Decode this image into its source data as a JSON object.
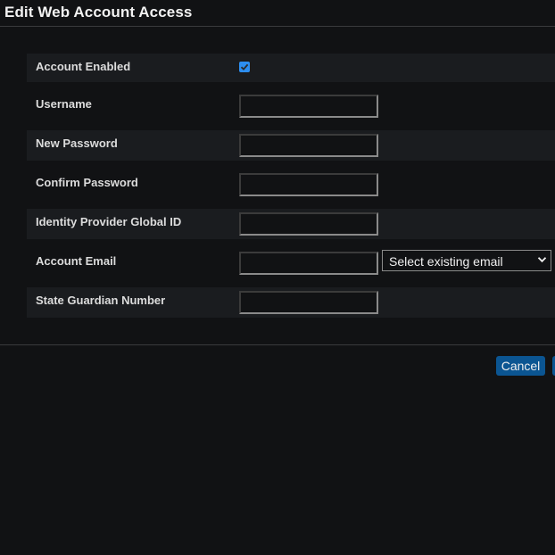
{
  "dialog": {
    "title": "Edit Web Account Access"
  },
  "fields": [
    {
      "label": "Account Enabled",
      "type": "checkbox",
      "checked": true
    },
    {
      "label": "Username",
      "type": "text",
      "value": ""
    },
    {
      "label": "New Password",
      "type": "password",
      "value": ""
    },
    {
      "label": "Confirm Password",
      "type": "password",
      "value": ""
    },
    {
      "label": "Identity Provider Global ID",
      "type": "text",
      "value": ""
    },
    {
      "label": "Account Email",
      "type": "text",
      "value": "",
      "select_value": "Select existing email"
    },
    {
      "label": "State Guardian Number",
      "type": "text",
      "value": ""
    }
  ],
  "footer": {
    "cancel_label": "Cancel"
  },
  "colors": {
    "accent": "#2d8ef0",
    "button": "#0b5592"
  }
}
